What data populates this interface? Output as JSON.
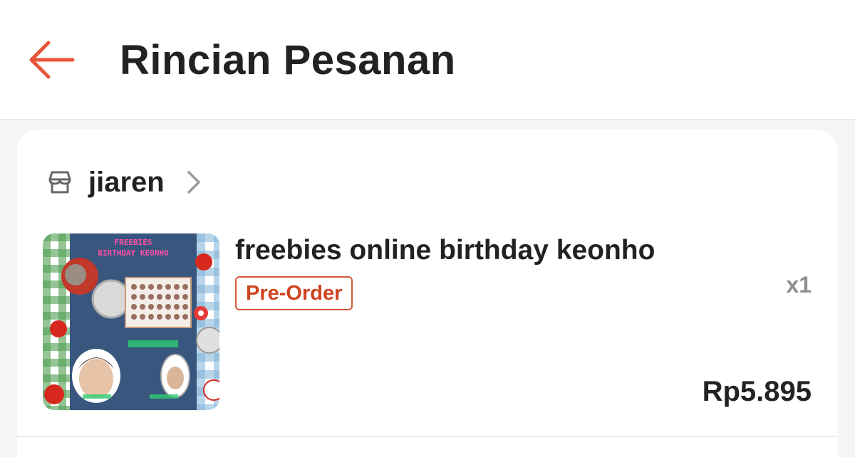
{
  "header": {
    "title": "Rincian Pesanan",
    "back_icon": "arrow-left-icon",
    "accent_color": "#e8553a"
  },
  "order": {
    "shop": {
      "icon": "store-icon",
      "name": "jiaren",
      "chevron_icon": "chevron-right-icon"
    },
    "item": {
      "name": "freebies online birthday keonho",
      "badge": "Pre-Order",
      "badge_color": "#d0431f",
      "quantity": "x1",
      "price": "Rp5.895",
      "thumbnail": {
        "title_line1": "FREEBIES",
        "title_line2": "BIRTHDAY KEONHO"
      }
    }
  }
}
